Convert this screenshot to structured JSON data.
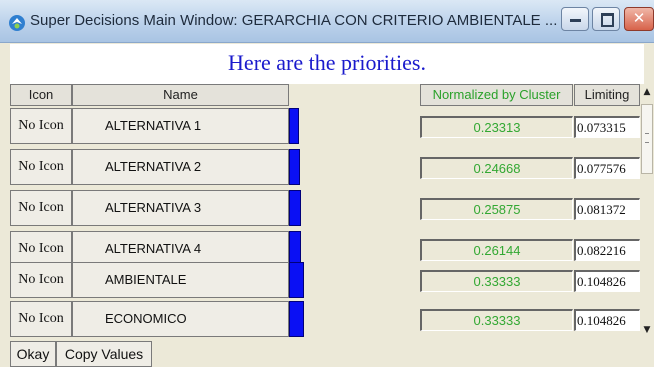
{
  "window": {
    "title": "Super Decisions Main Window: GERARCHIA CON CRITERIO AMBIENTALE ...",
    "close_glyph": "✕"
  },
  "heading": "Here are the priorities.",
  "columns": {
    "icon": "Icon",
    "name": "Name",
    "normalized": "Normalized by Cluster",
    "limiting": "Limiting"
  },
  "rows": [
    {
      "icon_label": "No Icon",
      "name": "ALTERNATIVA 1",
      "normalized": "0.23313",
      "limiting": "0.073315",
      "bar_fraction": 0.23313
    },
    {
      "icon_label": "No Icon",
      "name": "ALTERNATIVA 2",
      "normalized": "0.24668",
      "limiting": "0.077576",
      "bar_fraction": 0.24668
    },
    {
      "icon_label": "No Icon",
      "name": "ALTERNATIVA 3",
      "normalized": "0.25875",
      "limiting": "0.081372",
      "bar_fraction": 0.25875
    },
    {
      "icon_label": "No Icon",
      "name": "ALTERNATIVA 4",
      "normalized": "0.26144",
      "limiting": "0.082216",
      "bar_fraction": 0.26144
    },
    {
      "icon_label": "No Icon",
      "name": "AMBIENTALE",
      "normalized": "0.33333",
      "limiting": "0.104826",
      "bar_fraction": 0.33333
    },
    {
      "icon_label": "No Icon",
      "name": "ECONOMICO",
      "normalized": "0.33333",
      "limiting": "0.104826",
      "bar_fraction": 0.33333
    }
  ],
  "buttons": {
    "okay": "Okay",
    "copy_values": "Copy Values"
  },
  "colors": {
    "bar": "#0a10f4",
    "heading": "#1a1acc",
    "normalized_text": "#33a833"
  }
}
